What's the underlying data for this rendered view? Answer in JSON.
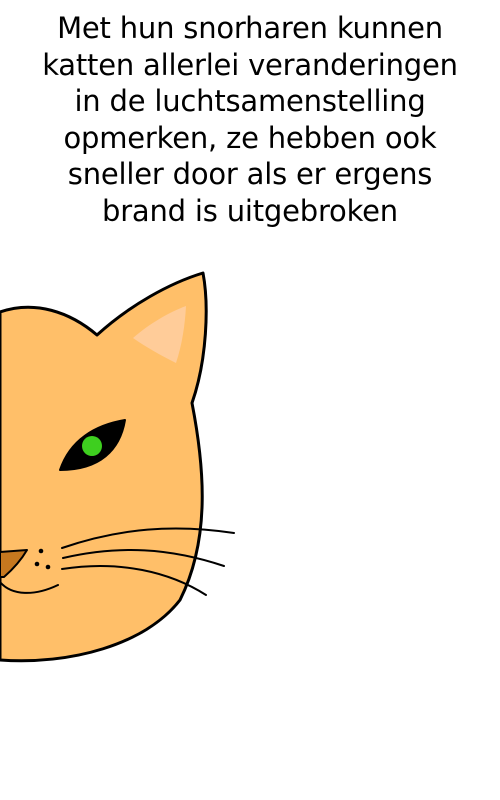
{
  "caption": {
    "text": "Met hun snorharen kunnen\nkatten allerlei veranderingen\nin de luchtsamenstelling\nopmerken,  ze hebben ook\nsneller door als er ergens\nbrand is uitgebroken"
  },
  "illustration": {
    "icon": "cat-face-icon",
    "colors": {
      "fur": "#ffbf69",
      "inner_ear": "#ffcc99",
      "eye_outline": "#000000",
      "iris": "#3ecf1f",
      "nose": "#c6781f",
      "outline": "#000000",
      "background": "#ffffff"
    }
  }
}
